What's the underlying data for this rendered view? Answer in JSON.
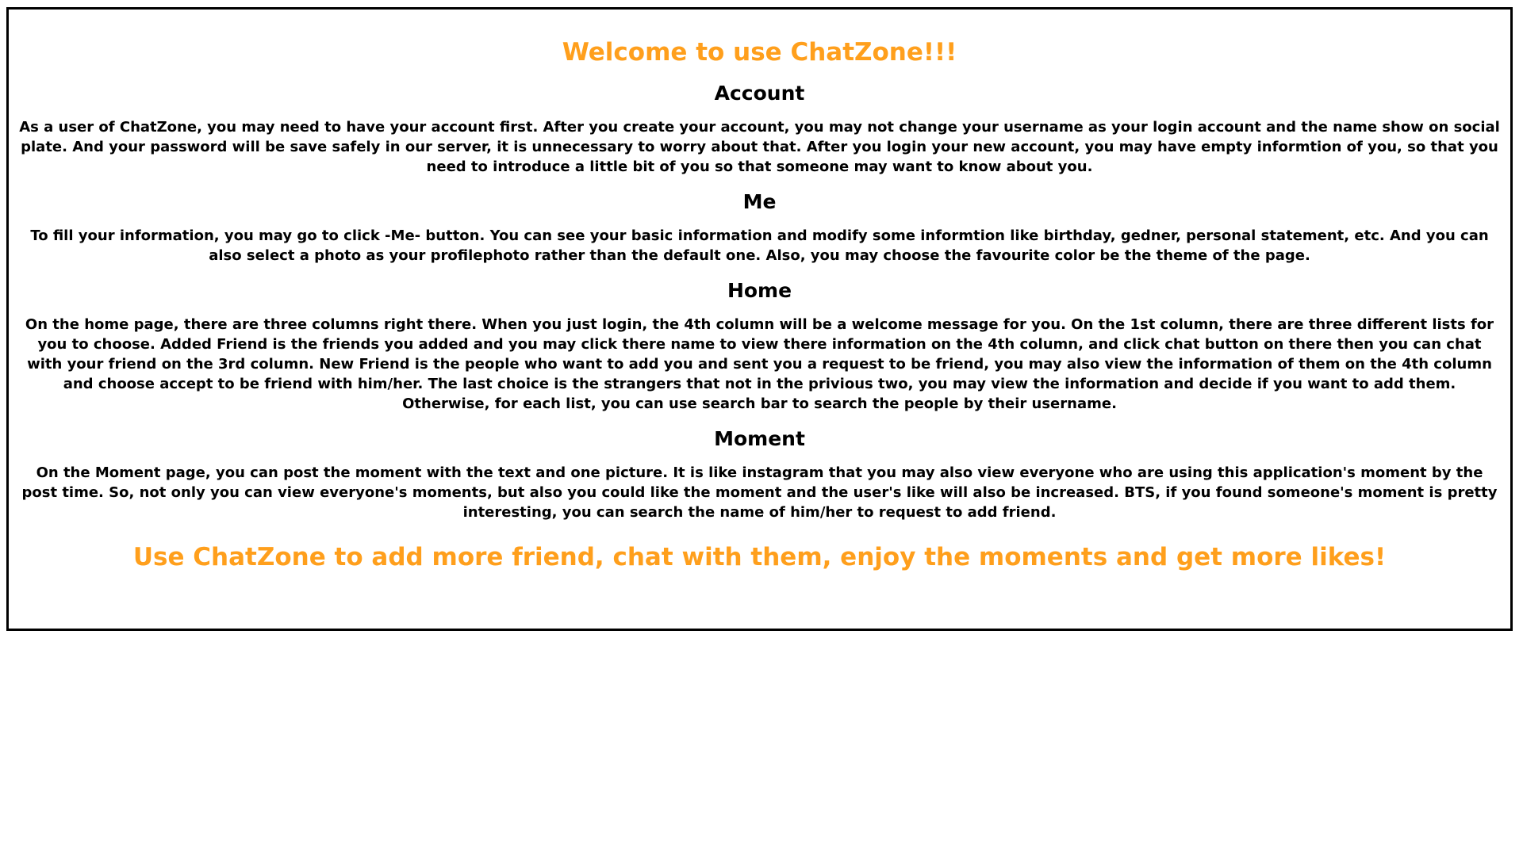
{
  "welcome_title": "Welcome to use ChatZone!!!",
  "sections": [
    {
      "title": "Account",
      "body": "As a user of ChatZone, you may need to have your account first. After you create your account, you may not change your username as your login account and the name show on social plate. And your password will be save safely in our server, it is unnecessary to worry about that. After you login your new account, you may have empty informtion of you, so that you need to introduce a little bit of you so that someone may want to know about you."
    },
    {
      "title": "Me",
      "body": "To fill your information, you may go to click -Me- button. You can see your basic information and modify some informtion like birthday, gedner, personal statement, etc. And you can also select a photo as your profilephoto rather than the default one. Also, you may choose the favourite color be the theme of the page."
    },
    {
      "title": "Home",
      "body": "On the home page, there are three columns right there. When you just login, the 4th column will be a welcome message for you. On the 1st column, there are three different lists for you to choose. Added Friend is the friends you added and you may click there name to view there information on the 4th column, and click chat button on there then you can chat with your friend on the 3rd column. New Friend is the people who want to add you and sent you a request to be friend, you may also view the information of them on the 4th column and choose accept to be friend with him/her. The last choice is the strangers that not in the privious two, you may view the information and decide if you want to add them. Otherwise, for each list, you can use search bar to search the people by their username."
    },
    {
      "title": "Moment",
      "body": "On the Moment page, you can post the moment with the text and one picture. It is like instagram that you may also view everyone who are using this application's moment by the post time. So, not only you can view everyone's moments, but also you could like the moment and the user's like will also be increased. BTS, if you found someone's moment is pretty interesting, you can search the name of him/her to request to add friend."
    }
  ],
  "footer_slogan": "Use ChatZone to add more friend, chat with them, enjoy the moments and get more likes!",
  "colors": {
    "accent": "#ff9f1c",
    "text": "#000000",
    "border": "#000000"
  }
}
